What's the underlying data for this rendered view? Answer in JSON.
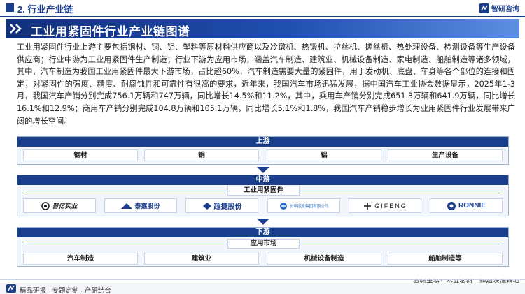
{
  "header": {
    "section_label": "2. 行业产业链",
    "brand_name": "智研咨询"
  },
  "banner": {
    "title": "工业用紧固件行业产业链图谱"
  },
  "paragraph": "工业用紧固件行业上游主要包括钢材、铜、铝、塑料等原材料供应商以及冷镦机、热锻机、拉丝机、搓丝机、热处理设备、检测设备等生产设备供应商；行业中游为工业用紧固件生产制造；行业下游为应用市场，涵盖汽车制造、建筑业、机械设备制造、家电制造、船舶制造等诸多领域，其中，汽车制造为我国工业用紧固件最大下游市场，占比超60%，汽车制造需要大量的紧固件，用于发动机、底盘、车身等各个部位的连接和固定，对紧固件的强度、精度、耐腐蚀性和可靠性有很高的要求，近年来，我国汽车市场迅猛发展，据中国汽车工业协会数据显示，2025年1-3月，我国汽车产销分别完成756.1万辆和747万辆，同比增长14.5%和11.2%，其中，乘用车产销分别完成651.3万辆和641.9万辆，同比增长16.1%和12.9%；商用车产销分别完成104.8万辆和105.1万辆，同比增长5.1%和1.8%，我国汽车产销稳步增长为业用紧固件行业发展带来广阔的增长空间。",
  "upstream": {
    "label": "上游",
    "items": [
      "钢材",
      "铜",
      "铝",
      "生产设备"
    ]
  },
  "midstream": {
    "label": "中游",
    "sub_label": "工业用紧固件",
    "logos": [
      {
        "text": "晋亿实业",
        "color": "#1a1a1a",
        "icon": "jinyi-logo-icon"
      },
      {
        "text": "泰嘉股份",
        "color": "#1a3e8c",
        "icon": "taijia-logo-icon"
      },
      {
        "text": "超捷股份",
        "color": "#1a3e8c",
        "icon": "chaojie-logo-icon"
      },
      {
        "text": "长华控股集团有限公司",
        "color": "#2c6cc0",
        "icon": "changhua-logo-icon"
      },
      {
        "text": "GIFENG",
        "color": "#1a1a1a",
        "icon": "gifeng-logo-icon"
      },
      {
        "text": "RONNIE",
        "color": "#1a3e8c",
        "icon": "ronnie-logo-icon"
      }
    ]
  },
  "downstream": {
    "label": "下游",
    "sub_label": "应用市场",
    "items": [
      "汽车制造",
      "建筑业",
      "机械设备制造",
      "船舶制造等"
    ]
  },
  "footer": {
    "source": "资料来源：公开资料、智研咨询整理",
    "slogan": "精品研报 · 专题定制 · 产研结合"
  },
  "colors": {
    "primary": "#1a3e8c",
    "panel_bg": "#f2f5fa"
  }
}
